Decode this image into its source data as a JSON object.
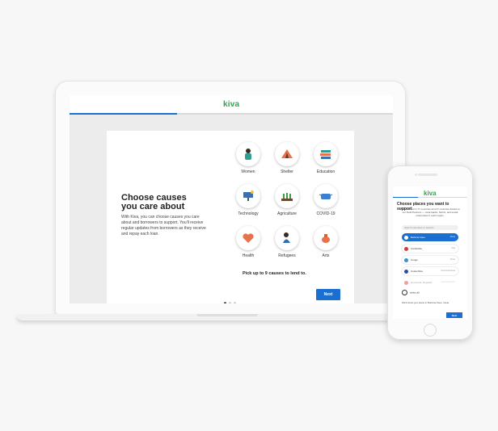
{
  "brand": {
    "logo": "kiva",
    "accent": "#1a6fd0",
    "logo_color": "#2aa84a"
  },
  "laptop": {
    "heading_line1": "Choose causes",
    "heading_line2": "you care about",
    "description": "With Kiva, you can choose causes you care about and borrowers to support. You'll receive regular updates from borrowers as they receive and repay each loan.",
    "causes": [
      {
        "label": "Women",
        "icon": "woman-icon"
      },
      {
        "label": "Shelter",
        "icon": "tent-icon"
      },
      {
        "label": "Education",
        "icon": "books-icon"
      },
      {
        "label": "Technology",
        "icon": "solar-panel-icon"
      },
      {
        "label": "Agriculture",
        "icon": "crops-icon"
      },
      {
        "label": "COVID-19",
        "icon": "mask-icon"
      },
      {
        "label": "Health",
        "icon": "heart-icon"
      },
      {
        "label": "Refugees",
        "icon": "refugee-icon"
      },
      {
        "label": "Arts",
        "icon": "pottery-icon"
      }
    ],
    "pick_text": "Pick up to 9 causes to lend to.",
    "next_label": "Next",
    "pagination": {
      "pages": 3,
      "active": 1
    }
  },
  "phone": {
    "heading": "Choose places you want to support",
    "description": "You can lend in 77 countries and 27 countries thanks to our Field Partners — local banks, NGOs, and social enterprises in each region.",
    "search_placeholder": "Search countries or sectors",
    "countries": [
      {
        "name": "Burkina Faso",
        "meta": "Africa",
        "selected": true,
        "faded": false
      },
      {
        "name": "Cambodia",
        "meta": "Asia",
        "selected": false,
        "faded": false
      },
      {
        "name": "Congo",
        "meta": "Africa",
        "selected": false,
        "faded": false
      },
      {
        "name": "Costa Rica",
        "meta": "Central America",
        "selected": false,
        "faded": false
      },
      {
        "name": "Dominican Republic",
        "meta": "Central America",
        "selected": false,
        "faded": true
      }
    ],
    "select_all_label": "select all",
    "note": "We'll show you loans in Burkina Faso. Clear",
    "next_label": "Next"
  }
}
